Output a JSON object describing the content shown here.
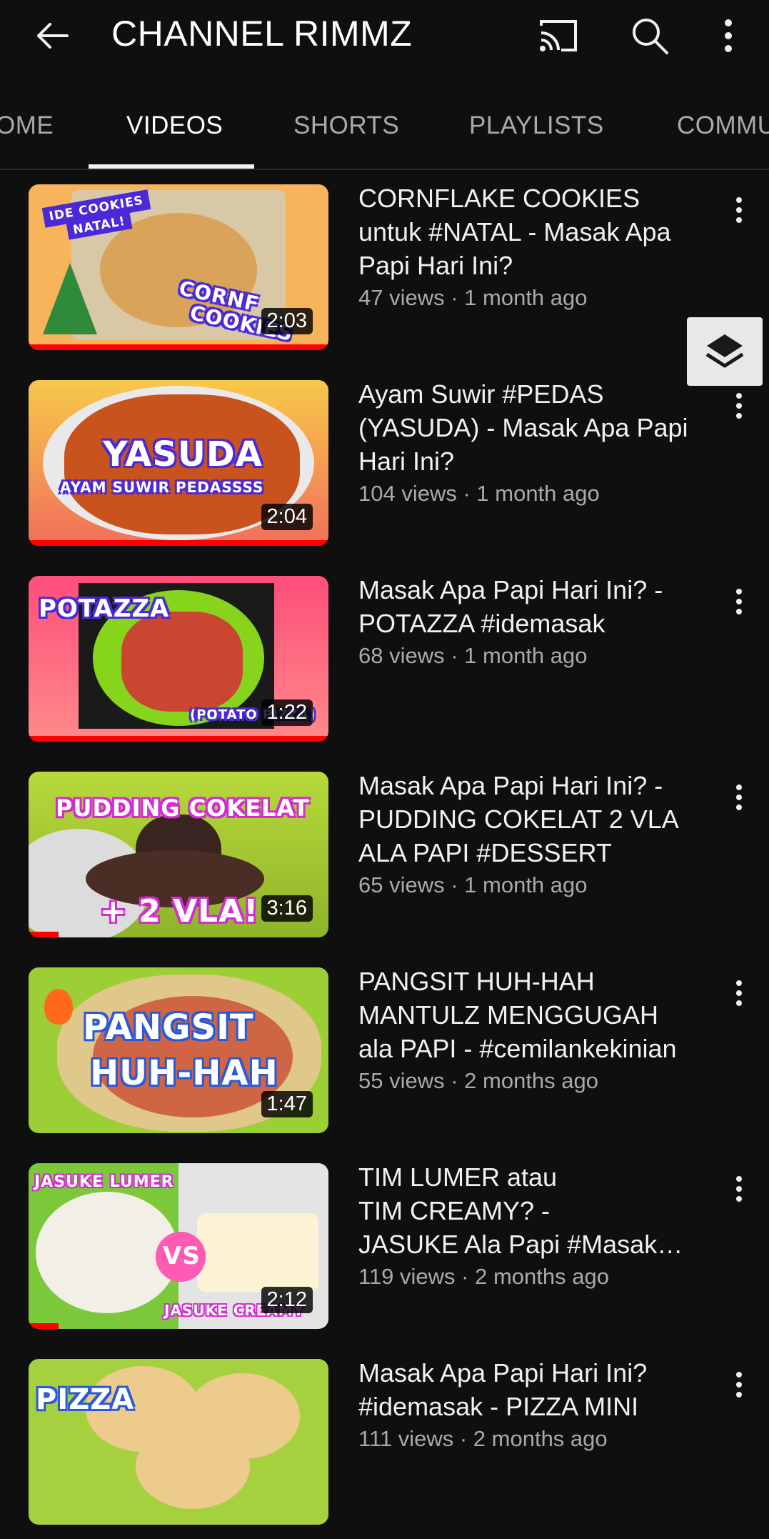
{
  "header": {
    "title": "CHANNEL RIMMZ",
    "back_icon": "arrow-left-icon",
    "cast_icon": "cast-icon",
    "search_icon": "search-icon",
    "more_icon": "more-vertical-icon"
  },
  "tabs": [
    {
      "label": "HOME",
      "shown_text": "OME",
      "active": false
    },
    {
      "label": "VIDEOS",
      "shown_text": "VIDEOS",
      "active": true
    },
    {
      "label": "SHORTS",
      "shown_text": "SHORTS",
      "active": false
    },
    {
      "label": "PLAYLISTS",
      "shown_text": "PLAYLISTS",
      "active": false
    },
    {
      "label": "COMMUNITY",
      "shown_text": "COMMU",
      "active": false
    }
  ],
  "videos": [
    {
      "title_lines": [
        "CORNFLAKE COOKIES",
        "untuk #NATAL - Masak Apa",
        "Papi Hari Ini?"
      ],
      "meta": "47 views · 1 month ago",
      "duration": "2:03",
      "thumb_text": [
        "IDE COOKIES",
        "NATAL!",
        "CORNF",
        "COOKIES"
      ],
      "watched_fraction": 1.0,
      "bg": "#f7b45a"
    },
    {
      "title_lines": [
        "Ayam Suwir #PEDAS",
        "(YASUDA) - Masak Apa Papi",
        "Hari Ini?"
      ],
      "meta": "104 views · 1 month ago",
      "duration": "2:04",
      "thumb_text": [
        "YASUDA",
        "AYAM SUWIR PEDASSSS"
      ],
      "watched_fraction": 1.0,
      "bg": "#e8552e"
    },
    {
      "title_lines": [
        "Masak Apa Papi Hari Ini? -",
        "POTAZZA #idemasak"
      ],
      "meta": "68 views · 1 month ago",
      "duration": "1:22",
      "thumb_text": [
        "POTAZZA",
        "(POTATO PIZZA)"
      ],
      "watched_fraction": 1.0,
      "bg": "#f2566a"
    },
    {
      "title_lines": [
        "Masak Apa Papi Hari Ini? -",
        "PUDDING COKELAT 2 VLA",
        "ALA PAPI #DESSERT"
      ],
      "meta": "65 views · 1 month ago",
      "duration": "3:16",
      "thumb_text": [
        "PUDDING COKELAT",
        "+ 2 VLA!"
      ],
      "watched_fraction": 0.1,
      "bg": "#a7cf2c"
    },
    {
      "title_lines": [
        "PANGSIT HUH-HAH",
        "MANTULZ MENGGUGAH",
        "ala PAPI - #cemilankekinian"
      ],
      "meta": "55 views · 2 months ago",
      "duration": "1:47",
      "thumb_text": [
        "PANGSIT",
        "HUH-HAH"
      ],
      "watched_fraction": 0,
      "bg": "#9ccf35"
    },
    {
      "title_lines": [
        "TIM LUMER atau",
        "TIM CREAMY? -",
        "JASUKE Ala Papi #Masak…"
      ],
      "meta": "119 views · 2 months ago",
      "duration": "2:12",
      "thumb_text": [
        "JASUKE LUMER",
        "VS",
        "JASUKE CREAMY"
      ],
      "watched_fraction": 0.1,
      "bg": "#7bc93a"
    },
    {
      "title_lines": [
        "Masak Apa Papi Hari Ini?",
        "#idemasak - PIZZA MINI"
      ],
      "meta": "111 views · 2 months ago",
      "duration": "",
      "thumb_text": [
        "PIZZA"
      ],
      "watched_fraction": 0,
      "bg": "#a6d13e"
    }
  ],
  "floating_button": {
    "icon": "layers-icon"
  }
}
